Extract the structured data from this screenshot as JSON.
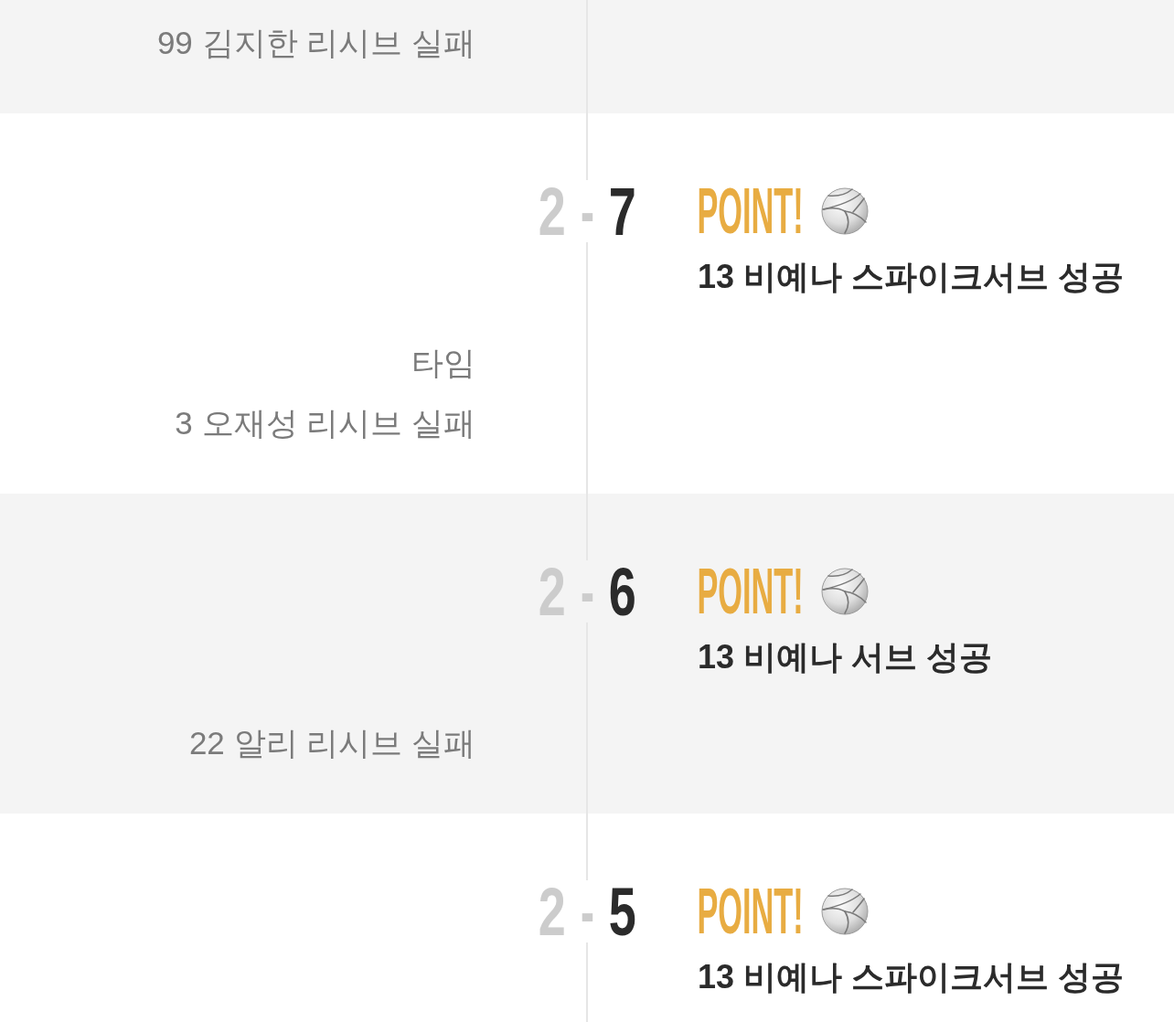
{
  "events": [
    {
      "left": [
        "99 김지한 리시브 실패"
      ]
    },
    {
      "score": {
        "home": {
          "points": "2",
          "highlighted": false
        },
        "separator": "-",
        "away": {
          "points": "7",
          "highlighted": true
        }
      },
      "point": {
        "label": "POINT!",
        "text": "13 비예나 스파이크서브 성공"
      },
      "left": [
        "타임",
        "3 오재성 리시브 실패"
      ]
    },
    {
      "score": {
        "home": {
          "points": "2",
          "highlighted": false
        },
        "separator": "-",
        "away": {
          "points": "6",
          "highlighted": true
        }
      },
      "point": {
        "label": "POINT!",
        "text": "13 비예나 서브 성공"
      },
      "left": [
        "22 알리 리시브 실패"
      ]
    },
    {
      "score": {
        "home": {
          "points": "2",
          "highlighted": false
        },
        "separator": "-",
        "away": {
          "points": "5",
          "highlighted": true
        }
      },
      "point": {
        "label": "POINT!",
        "text": "13 비예나 스파이크서브 성공"
      }
    }
  ]
}
